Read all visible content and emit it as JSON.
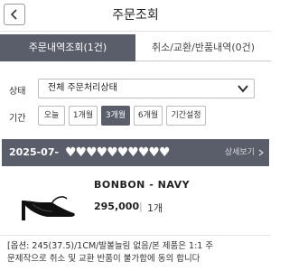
{
  "header": {
    "title": "주문조회",
    "back_icon": "chevron-left-icon"
  },
  "tabs": [
    {
      "label": "주문내역조회(1건)",
      "active": true
    },
    {
      "label": "취소/교환/반품내역(0건)",
      "active": false
    }
  ],
  "filters": {
    "status_label": "상태",
    "status_value": "전체 주문처리상태",
    "period_label": "기간",
    "periods": [
      "오늘",
      "1개월",
      "3개월",
      "6개월",
      "기간설정"
    ],
    "selected_period": "3개월"
  },
  "order": {
    "date": "2025-07-",
    "masked": "♥♥♥♥♥♥♥♥♥♥",
    "detail_link": "상세보기",
    "product_name": "BONBON - NAVY",
    "price": "295,000",
    "qty_separator": "|",
    "quantity": "1개",
    "options_line1": "[옵션: 245(37.5)/1CM/발볼늘림 없음/본 제품은 1:1 주",
    "options_line2": "문제작으로 취소 및 교환 반품이 불가함에 동의 합니다"
  },
  "colors": {
    "accent": "#5a5d6a",
    "border": "#bdbdbd"
  }
}
